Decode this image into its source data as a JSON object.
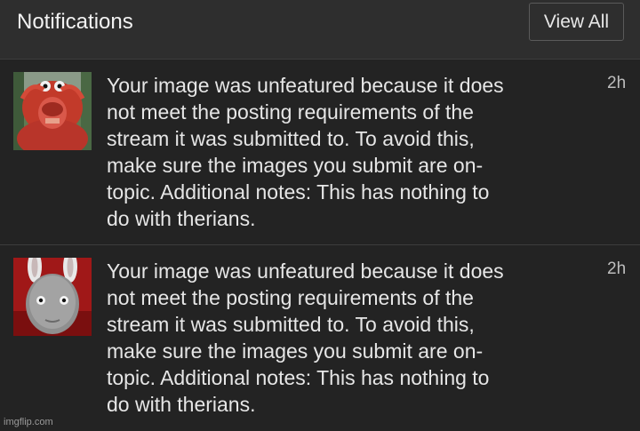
{
  "header": {
    "title": "Notifications",
    "view_all_label": "View All"
  },
  "notifications": [
    {
      "avatar": "red-creature-thumbnail",
      "lines": [
        "Your image was unfeatured because it does",
        "not meet the posting requirements of the",
        "stream it was submitted to. To avoid this,",
        "make sure the images you submit are on-",
        "topic. Additional notes: This has nothing to",
        "do with therians."
      ],
      "time": "2h"
    },
    {
      "avatar": "gray-bunny-ears-face-thumbnail",
      "lines": [
        "Your image was unfeatured because it does",
        "not meet the posting requirements of the",
        "stream it was submitted to. To avoid this,",
        "make sure the images you submit are on-",
        "topic. Additional notes: This has nothing to",
        "do with therians."
      ],
      "time": "2h"
    }
  ],
  "watermark": "imgflip.com",
  "colors": {
    "background": "#232323",
    "header_background": "#2e2e2e",
    "divider": "#3d3d3d",
    "text": "#e6e6e6"
  }
}
